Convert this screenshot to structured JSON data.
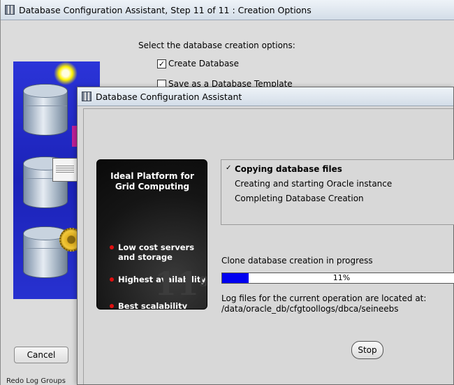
{
  "back_window": {
    "title": "Database Configuration Assistant, Step 11 of 11 : Creation Options",
    "heading": "Select the database creation options:",
    "options": [
      {
        "label": "Create Database",
        "checked": true
      },
      {
        "label": "Save as a Database Template",
        "checked": false
      }
    ],
    "cancel_label": "Cancel",
    "status_label": "Redo Log Groups"
  },
  "dialog": {
    "title": "Database Configuration Assistant",
    "promo": {
      "title": "Ideal Platform for Grid Computing",
      "items": [
        "Low cost servers and storage",
        "Highest availability",
        "Best scalability"
      ],
      "mark": "11",
      "mark_sup": "g"
    },
    "steps": [
      {
        "label": "Copying database files",
        "active": true
      },
      {
        "label": "Creating and starting Oracle instance",
        "active": false
      },
      {
        "label": "Completing Database Creation",
        "active": false
      }
    ],
    "step_check": "✓",
    "progress_label": "Clone database creation in progress",
    "progress_percent": 11,
    "progress_text": "11%",
    "log_line1": "Log files for the current operation are located at:",
    "log_line2": "/data/oracle_db/cfgtoollogs/dbca/seineebs",
    "stop_label": "Stop"
  }
}
